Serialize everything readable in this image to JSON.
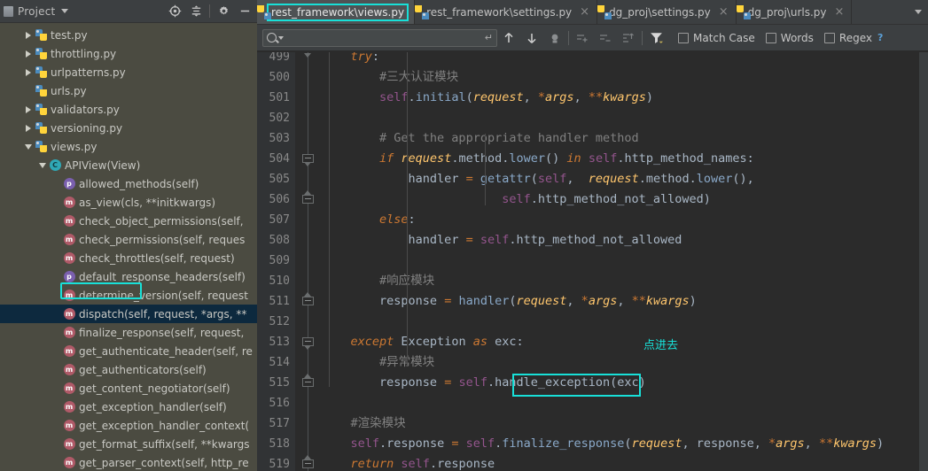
{
  "sidebar": {
    "title": "Project",
    "header_icons": [
      "locate-icon",
      "collapse-all-icon",
      "settings-gear-icon",
      "minimize-icon"
    ],
    "tree": [
      {
        "indent": 1,
        "twist": "right",
        "icon": "python-file-icon",
        "label": "test.py",
        "kind": "file"
      },
      {
        "indent": 1,
        "twist": "right",
        "icon": "python-file-icon",
        "label": "throttling.py",
        "kind": "file"
      },
      {
        "indent": 1,
        "twist": "right",
        "icon": "python-file-icon",
        "label": "urlpatterns.py",
        "kind": "file"
      },
      {
        "indent": 1,
        "twist": "none",
        "icon": "python-file-icon",
        "label": "urls.py",
        "kind": "file"
      },
      {
        "indent": 1,
        "twist": "right",
        "icon": "python-file-icon",
        "label": "validators.py",
        "kind": "file"
      },
      {
        "indent": 1,
        "twist": "right",
        "icon": "python-file-icon",
        "label": "versioning.py",
        "kind": "file"
      },
      {
        "indent": 1,
        "twist": "down",
        "icon": "python-file-icon",
        "label": "views.py",
        "kind": "file"
      },
      {
        "indent": 2,
        "twist": "down",
        "icon": "class-badge",
        "label": "APIView(View)",
        "kind": "class"
      },
      {
        "indent": 3,
        "twist": "none",
        "icon": "property-badge",
        "label": "allowed_methods(self)",
        "kind": "property"
      },
      {
        "indent": 3,
        "twist": "none",
        "icon": "method-badge",
        "label": "as_view(cls, **initkwargs)",
        "kind": "method"
      },
      {
        "indent": 3,
        "twist": "none",
        "icon": "method-badge",
        "label": "check_object_permissions(self,",
        "kind": "method"
      },
      {
        "indent": 3,
        "twist": "none",
        "icon": "method-badge",
        "label": "check_permissions(self, reques",
        "kind": "method"
      },
      {
        "indent": 3,
        "twist": "none",
        "icon": "method-badge",
        "label": "check_throttles(self, request)",
        "kind": "method"
      },
      {
        "indent": 3,
        "twist": "none",
        "icon": "property-badge",
        "label": "default_response_headers(self)",
        "kind": "property"
      },
      {
        "indent": 3,
        "twist": "none",
        "icon": "method-badge",
        "label": "determine_version(self, request",
        "kind": "method"
      },
      {
        "indent": 3,
        "twist": "none",
        "icon": "method-badge",
        "label": "dispatch(self, request, *args, **",
        "kind": "method",
        "selected": true
      },
      {
        "indent": 3,
        "twist": "none",
        "icon": "method-badge",
        "label": "finalize_response(self, request,",
        "kind": "method"
      },
      {
        "indent": 3,
        "twist": "none",
        "icon": "method-badge",
        "label": "get_authenticate_header(self, re",
        "kind": "method"
      },
      {
        "indent": 3,
        "twist": "none",
        "icon": "method-badge",
        "label": "get_authenticators(self)",
        "kind": "method"
      },
      {
        "indent": 3,
        "twist": "none",
        "icon": "method-badge",
        "label": "get_content_negotiator(self)",
        "kind": "method"
      },
      {
        "indent": 3,
        "twist": "none",
        "icon": "method-badge",
        "label": "get_exception_handler(self)",
        "kind": "method"
      },
      {
        "indent": 3,
        "twist": "none",
        "icon": "method-badge",
        "label": "get_exception_handler_context(",
        "kind": "method"
      },
      {
        "indent": 3,
        "twist": "none",
        "icon": "method-badge",
        "label": "get_format_suffix(self, **kwargs",
        "kind": "method"
      },
      {
        "indent": 3,
        "twist": "none",
        "icon": "method-badge",
        "label": "get_parser_context(self, http_re",
        "kind": "method"
      }
    ]
  },
  "tabs": [
    {
      "label": "rest_framework\\views.py",
      "active": true,
      "closable": false,
      "highlighted": true
    },
    {
      "label": "rest_framework\\settings.py",
      "active": false,
      "closable": true,
      "highlighted": false
    },
    {
      "label": "dg_proj\\settings.py",
      "active": false,
      "closable": true,
      "highlighted": false
    },
    {
      "label": "dg_proj\\urls.py",
      "active": false,
      "closable": true,
      "highlighted": false
    }
  ],
  "find": {
    "value": "",
    "placeholder": "",
    "buttons": [
      "find-previous-icon",
      "find-next-icon",
      "select-all-occurrences-icon",
      "add-line-icon",
      "remove-line-icon",
      "new-line-icon",
      "filter-icon"
    ],
    "match_case": {
      "label": "Match Case",
      "checked": false
    },
    "words": {
      "label": "Words",
      "checked": false
    },
    "regex": {
      "label": "Regex",
      "checked": false
    },
    "help": "?"
  },
  "editor": {
    "first_line": 499,
    "lines": [
      {
        "n": 499,
        "fold": "tri-down",
        "tokens": [
          {
            "t": "    ",
            "c": "punct"
          },
          {
            "t": "try",
            "c": "kwi"
          },
          {
            "t": ":",
            "c": "punct"
          }
        ]
      },
      {
        "n": 500,
        "fold": "",
        "tokens": [
          {
            "t": "        ",
            "c": "punct"
          },
          {
            "t": "#三大认证模块",
            "c": "cmt"
          }
        ]
      },
      {
        "n": 501,
        "fold": "",
        "tokens": [
          {
            "t": "        ",
            "c": "punct"
          },
          {
            "t": "self",
            "c": "self"
          },
          {
            "t": ".",
            "c": "punct"
          },
          {
            "t": "initial",
            "c": "lowr"
          },
          {
            "t": "(",
            "c": "punct"
          },
          {
            "t": "request",
            "c": "parm"
          },
          {
            "t": ", ",
            "c": "punct"
          },
          {
            "t": "*",
            "c": "kw"
          },
          {
            "t": "args",
            "c": "parm"
          },
          {
            "t": ", ",
            "c": "punct"
          },
          {
            "t": "**",
            "c": "kw"
          },
          {
            "t": "kwargs",
            "c": "parm"
          },
          {
            "t": ")",
            "c": "punct"
          }
        ]
      },
      {
        "n": 502,
        "fold": "",
        "tokens": []
      },
      {
        "n": 503,
        "fold": "",
        "tokens": [
          {
            "t": "        ",
            "c": "punct"
          },
          {
            "t": "# Get the appropriate handler method",
            "c": "cmt"
          }
        ]
      },
      {
        "n": 504,
        "fold": "box-down",
        "tokens": [
          {
            "t": "        ",
            "c": "punct"
          },
          {
            "t": "if ",
            "c": "kwi"
          },
          {
            "t": "request",
            "c": "parm"
          },
          {
            "t": ".",
            "c": "punct"
          },
          {
            "t": "method",
            "c": "meth"
          },
          {
            "t": ".",
            "c": "punct"
          },
          {
            "t": "lower",
            "c": "lowr"
          },
          {
            "t": "() ",
            "c": "punct"
          },
          {
            "t": "in ",
            "c": "kwi"
          },
          {
            "t": "self",
            "c": "self"
          },
          {
            "t": ".",
            "c": "punct"
          },
          {
            "t": "http_method_names",
            "c": "meth"
          },
          {
            "t": ":",
            "c": "punct"
          }
        ]
      },
      {
        "n": 505,
        "fold": "",
        "tokens": [
          {
            "t": "            ",
            "c": "punct"
          },
          {
            "t": "handler ",
            "c": "meth"
          },
          {
            "t": "= ",
            "c": "kw"
          },
          {
            "t": "getattr",
            "c": "lowr"
          },
          {
            "t": "(",
            "c": "punct"
          },
          {
            "t": "self",
            "c": "self"
          },
          {
            "t": ",  ",
            "c": "punct"
          },
          {
            "t": "request",
            "c": "parm"
          },
          {
            "t": ".",
            "c": "punct"
          },
          {
            "t": "method",
            "c": "meth"
          },
          {
            "t": ".",
            "c": "punct"
          },
          {
            "t": "lower",
            "c": "lowr"
          },
          {
            "t": "(),",
            "c": "punct"
          }
        ]
      },
      {
        "n": 506,
        "fold": "box-up",
        "tokens": [
          {
            "t": "                         ",
            "c": "punct"
          },
          {
            "t": "self",
            "c": "self"
          },
          {
            "t": ".",
            "c": "punct"
          },
          {
            "t": "http_method_not_allowed",
            "c": "meth"
          },
          {
            "t": ")",
            "c": "punct"
          }
        ]
      },
      {
        "n": 507,
        "fold": "",
        "tokens": [
          {
            "t": "        ",
            "c": "punct"
          },
          {
            "t": "else",
            "c": "kwi"
          },
          {
            "t": ":",
            "c": "punct"
          }
        ]
      },
      {
        "n": 508,
        "fold": "",
        "tokens": [
          {
            "t": "            ",
            "c": "punct"
          },
          {
            "t": "handler ",
            "c": "meth"
          },
          {
            "t": "= ",
            "c": "kw"
          },
          {
            "t": "self",
            "c": "self"
          },
          {
            "t": ".",
            "c": "punct"
          },
          {
            "t": "http_method_not_allowed",
            "c": "meth"
          }
        ]
      },
      {
        "n": 509,
        "fold": "",
        "tokens": []
      },
      {
        "n": 510,
        "fold": "",
        "tokens": [
          {
            "t": "        ",
            "c": "punct"
          },
          {
            "t": "#响应模块",
            "c": "cmt"
          }
        ]
      },
      {
        "n": 511,
        "fold": "box-up",
        "tokens": [
          {
            "t": "        ",
            "c": "punct"
          },
          {
            "t": "response ",
            "c": "meth"
          },
          {
            "t": "= ",
            "c": "kw"
          },
          {
            "t": "handler",
            "c": "lowr"
          },
          {
            "t": "(",
            "c": "punct"
          },
          {
            "t": "request",
            "c": "parm"
          },
          {
            "t": ", ",
            "c": "punct"
          },
          {
            "t": "*",
            "c": "kw"
          },
          {
            "t": "args",
            "c": "parm"
          },
          {
            "t": ", ",
            "c": "punct"
          },
          {
            "t": "**",
            "c": "kw"
          },
          {
            "t": "kwargs",
            "c": "parm"
          },
          {
            "t": ")",
            "c": "punct"
          }
        ]
      },
      {
        "n": 512,
        "fold": "",
        "tokens": []
      },
      {
        "n": 513,
        "fold": "box-down",
        "tokens": [
          {
            "t": "    ",
            "c": "punct"
          },
          {
            "t": "except ",
            "c": "kwi"
          },
          {
            "t": "Exception ",
            "c": "meth"
          },
          {
            "t": "as ",
            "c": "kwi"
          },
          {
            "t": "exc",
            "c": "meth"
          },
          {
            "t": ":",
            "c": "punct"
          }
        ]
      },
      {
        "n": 514,
        "fold": "",
        "tokens": [
          {
            "t": "        ",
            "c": "punct"
          },
          {
            "t": "#异常模块",
            "c": "cmt"
          }
        ]
      },
      {
        "n": 515,
        "fold": "box-up",
        "tokens": [
          {
            "t": "        ",
            "c": "punct"
          },
          {
            "t": "response ",
            "c": "meth"
          },
          {
            "t": "= ",
            "c": "kw"
          },
          {
            "t": "self",
            "c": "self"
          },
          {
            "t": ".",
            "c": "punct"
          },
          {
            "t": "handle_exception",
            "c": "meth"
          },
          {
            "t": "(exc)",
            "c": "punct"
          }
        ]
      },
      {
        "n": 516,
        "fold": "",
        "tokens": []
      },
      {
        "n": 517,
        "fold": "",
        "tokens": [
          {
            "t": "    ",
            "c": "punct"
          },
          {
            "t": "#渲染模块",
            "c": "cmt"
          }
        ]
      },
      {
        "n": 518,
        "fold": "",
        "tokens": [
          {
            "t": "    ",
            "c": "punct"
          },
          {
            "t": "self",
            "c": "self"
          },
          {
            "t": ".",
            "c": "punct"
          },
          {
            "t": "response ",
            "c": "meth"
          },
          {
            "t": "= ",
            "c": "kw"
          },
          {
            "t": "self",
            "c": "self"
          },
          {
            "t": ".",
            "c": "punct"
          },
          {
            "t": "finalize_response",
            "c": "lowr"
          },
          {
            "t": "(",
            "c": "punct"
          },
          {
            "t": "request",
            "c": "parm"
          },
          {
            "t": ", response, ",
            "c": "punct"
          },
          {
            "t": "*",
            "c": "kw"
          },
          {
            "t": "args",
            "c": "parm"
          },
          {
            "t": ", ",
            "c": "punct"
          },
          {
            "t": "**",
            "c": "kw"
          },
          {
            "t": "kwargs",
            "c": "parm"
          },
          {
            "t": ")",
            "c": "punct"
          }
        ]
      },
      {
        "n": 519,
        "fold": "box-up",
        "tokens": [
          {
            "t": "    ",
            "c": "punct"
          },
          {
            "t": "return ",
            "c": "kwi"
          },
          {
            "t": "self",
            "c": "self"
          },
          {
            "t": ".",
            "c": "punct"
          },
          {
            "t": "response",
            "c": "meth"
          }
        ]
      }
    ]
  },
  "annotations": {
    "note_text": "点进去",
    "highlight_color": "#18e0d8"
  }
}
